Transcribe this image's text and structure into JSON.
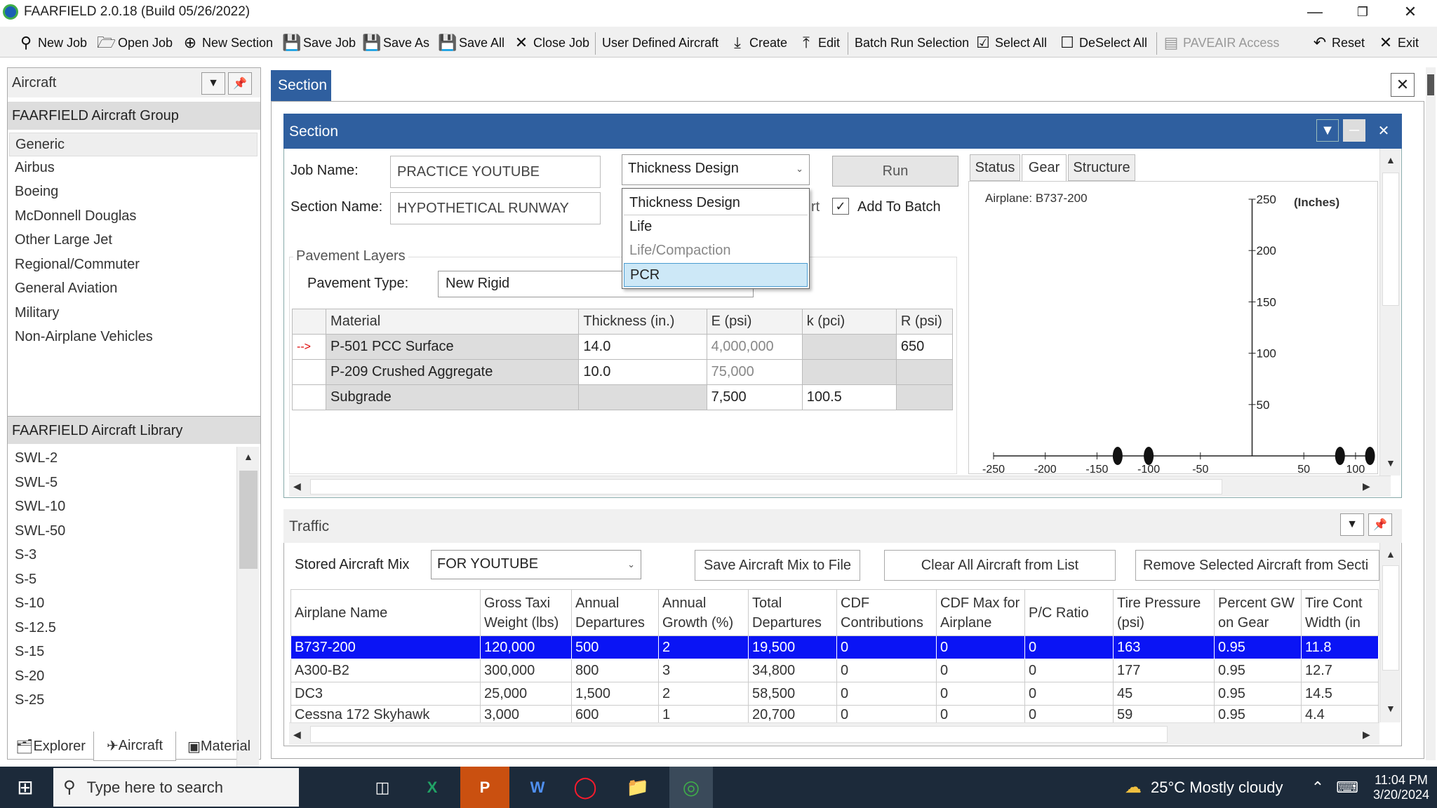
{
  "window": {
    "title": "FAARFIELD 2.0.18 (Build 05/26/2022)"
  },
  "toolbar": {
    "new_job": "New Job",
    "open_job": "Open Job",
    "new_section": "New Section",
    "save_job": "Save Job",
    "save_as": "Save As",
    "save_all": "Save All",
    "close_job": "Close Job",
    "user_defined": "User Defined Aircraft",
    "create": "Create",
    "edit": "Edit",
    "batch_run": "Batch Run Selection",
    "select_all": "Select All",
    "deselect_all": "DeSelect All",
    "paveair": "PAVEAIR Access",
    "reset": "Reset",
    "exit": "Exit"
  },
  "left": {
    "header": "Aircraft",
    "group_title": "FAARFIELD Aircraft Group",
    "groups": [
      "Generic",
      "Airbus",
      "Boeing",
      "McDonnell Douglas",
      "Other Large Jet",
      "Regional/Commuter",
      "General Aviation",
      "Military",
      "Non-Airplane Vehicles"
    ],
    "library_title": "FAARFIELD Aircraft Library",
    "library": [
      "SWL-2",
      "SWL-5",
      "SWL-10",
      "SWL-50",
      "S-3",
      "S-5",
      "S-10",
      "S-12.5",
      "S-15",
      "S-20",
      "S-25"
    ],
    "tabs": [
      "Explorer",
      "Aircraft",
      "Material"
    ]
  },
  "section": {
    "tab": "Section",
    "header": "Section",
    "job_label": "Job Name:",
    "job_value": "PRACTICE YOUTUBE",
    "section_label": "Section Name:",
    "section_value": "HYPOTHETICAL RUNWAY",
    "design_mode": "Thickness Design",
    "run": "Run",
    "add_to_batch": "Add To Batch",
    "rt_partial": "rt",
    "dropdown": [
      "Thickness Design",
      "Life",
      "Life/Compaction",
      "PCR"
    ],
    "layers_title": "Pavement Layers",
    "ptype_label": "Pavement Type:",
    "ptype_value": "New Rigid",
    "columns": [
      "Material",
      "Thickness (in.)",
      "E (psi)",
      "k (pci)",
      "R (psi)"
    ],
    "rows": [
      {
        "marker": "-->",
        "material": "P-501 PCC Surface",
        "thickness": "14.0",
        "e": "4,000,000",
        "k": "",
        "r": "650"
      },
      {
        "marker": "",
        "material": "P-209 Crushed Aggregate",
        "thickness": "10.0",
        "e": "75,000",
        "k": "",
        "r": ""
      },
      {
        "marker": "",
        "material": "Subgrade",
        "thickness": "",
        "e": "7,500",
        "k": "100.5",
        "r": ""
      }
    ]
  },
  "right_tabs": [
    "Status",
    "Gear",
    "Structure"
  ],
  "gear_chart": {
    "airplane": "Airplane: B737-200",
    "units": "(Inches)",
    "x_ticks": [
      "-250",
      "-200",
      "-150",
      "-100",
      "-50",
      "50",
      "100"
    ],
    "y_ticks": [
      "250",
      "200",
      "150",
      "100",
      "50"
    ]
  },
  "chart_data": {
    "type": "scatter",
    "title": "Airplane: B737-200",
    "ylabel": "(Inches)",
    "x": [
      -130,
      -100,
      85,
      114
    ],
    "y": [
      0,
      0,
      0,
      0
    ],
    "xlim": [
      -250,
      115
    ],
    "ylim": [
      0,
      250
    ]
  },
  "traffic": {
    "header": "Traffic",
    "mix_label": "Stored Aircraft Mix",
    "mix_value": "FOR YOUTUBE",
    "save_mix": "Save Aircraft Mix to File",
    "clear_all": "Clear All Aircraft from List",
    "remove_sel": "Remove Selected Aircraft from Secti",
    "columns": [
      "Airplane Name",
      "Gross Taxi Weight (lbs)",
      "Annual Departures",
      "Annual Growth (%)",
      "Total Departures",
      "CDF Contributions",
      "CDF Max for Airplane",
      "P/C Ratio",
      "Tire Pressure (psi)",
      "Percent GW on Gear",
      "Tire Cont Width (in"
    ],
    "rows": [
      [
        "B737-200",
        "120,000",
        "500",
        "2",
        "19,500",
        "0",
        "0",
        "0",
        "163",
        "0.95",
        "11.8"
      ],
      [
        "A300-B2",
        "300,000",
        "800",
        "3",
        "34,800",
        "0",
        "0",
        "0",
        "177",
        "0.95",
        "12.7"
      ],
      [
        "DC3",
        "25,000",
        "1,500",
        "2",
        "58,500",
        "0",
        "0",
        "0",
        "45",
        "0.95",
        "14.5"
      ],
      [
        "Cessna 172 Skyhawk",
        "3,000",
        "600",
        "1",
        "20,700",
        "0",
        "0",
        "0",
        "59",
        "0.95",
        "4.4"
      ]
    ]
  },
  "taskbar": {
    "search": "Type here to search",
    "weather": "25°C  Mostly cloudy",
    "time": "11:04 PM",
    "date": "3/20/2024"
  }
}
